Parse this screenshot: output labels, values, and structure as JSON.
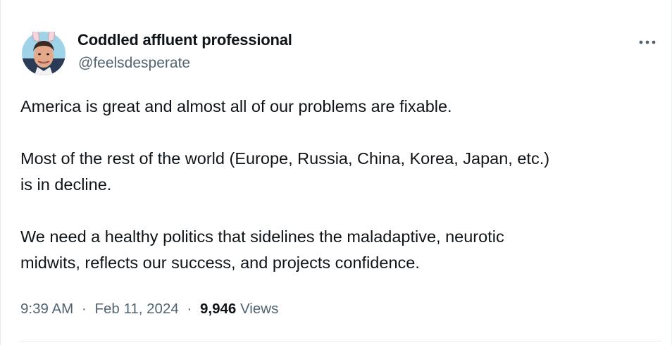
{
  "author": {
    "display_name": "Coddled affluent professional",
    "handle": "@feelsdesperate",
    "avatar_icon": "profile-photo-with-bunny-ears"
  },
  "more_icon": "more-horizontal-icon",
  "paragraphs": [
    "America is great and almost all of our problems are fixable.",
    "Most of the rest of the world (Europe, Russia, China, Korea, Japan, etc.)\nis in decline.",
    "We need a healthy politics that sidelines the maladaptive, neurotic\nmidwits, reflects our success, and projects confidence."
  ],
  "meta": {
    "time": "9:39 AM",
    "separator": "·",
    "date": "Feb 11, 2024",
    "views_count": "9,946",
    "views_label": "Views"
  },
  "colors": {
    "text_primary": "#0f1419",
    "text_secondary": "#536471"
  }
}
